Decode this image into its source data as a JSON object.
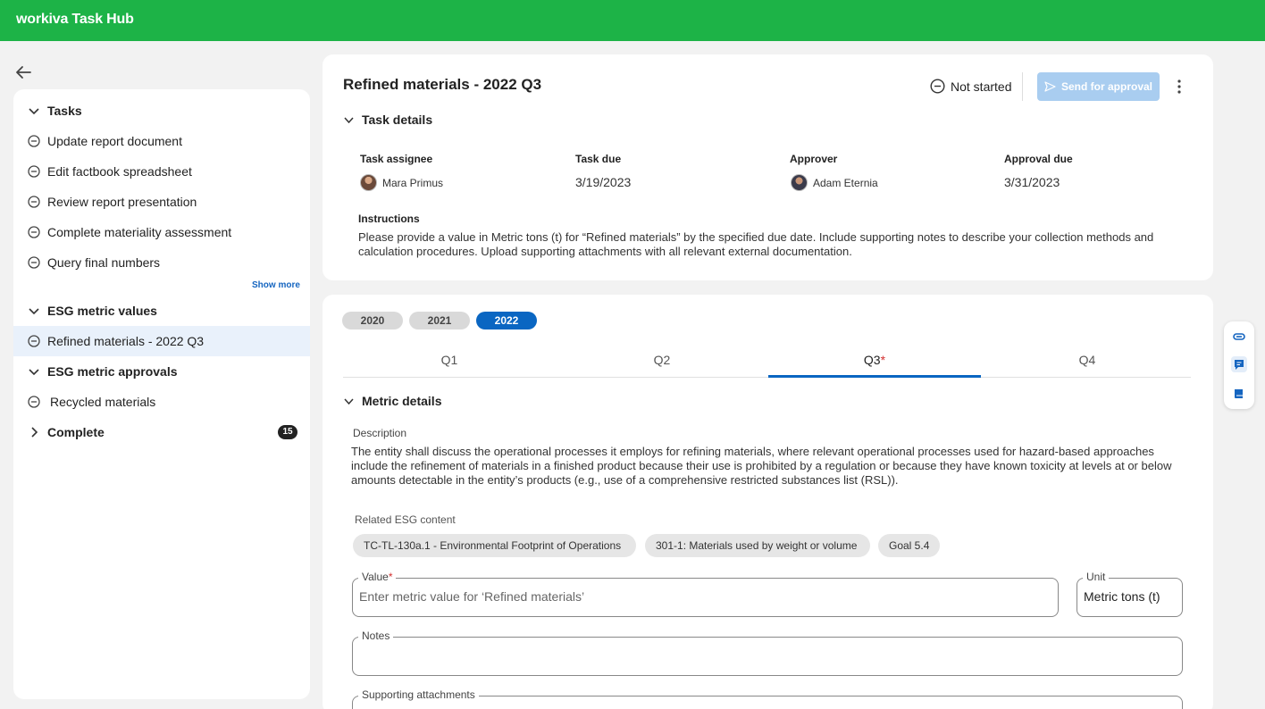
{
  "app": {
    "brand": "workiva Task Hub"
  },
  "sidebar": {
    "sections": [
      {
        "label": "Tasks",
        "items": [
          "Update report document",
          "Edit factbook spreadsheet",
          "Review report presentation",
          "Complete materiality assessment",
          "Query final numbers"
        ],
        "show_more": "Show more"
      },
      {
        "label": "ESG metric values",
        "items": [
          "Refined materials - 2022 Q3"
        ],
        "selected": "Refined materials - 2022 Q3"
      },
      {
        "label": "ESG metric approvals",
        "items": [
          "Recycled materials"
        ]
      },
      {
        "label": "Complete",
        "count": "15",
        "collapsed": true
      }
    ]
  },
  "task": {
    "title": "Refined materials - 2022 Q3",
    "status": "Not started",
    "send_label": "Send for approval",
    "details_header": "Task details",
    "fields": {
      "assignee_label": "Task assignee",
      "assignee": "Mara Primus",
      "due_label": "Task due",
      "due": "3/19/2023",
      "approver_label": "Approver",
      "approver": "Adam Eternia",
      "approval_due_label": "Approval due",
      "approval_due": "3/31/2023"
    },
    "instructions_label": "Instructions",
    "instructions": "Please provide a value in Metric tons (t) for “Refined materials” by the specified due date.  Include supporting notes to describe your collection methods and calculation procedures.  Upload supporting attachments with all relevant external documentation."
  },
  "metric": {
    "years": [
      "2020",
      "2021",
      "2022"
    ],
    "active_year": "2022",
    "quarters": [
      "Q1",
      "Q2",
      "Q3",
      "Q4"
    ],
    "active_quarter": "Q3",
    "required_mark": "*",
    "details_header": "Metric details",
    "description_label": "Description",
    "description": "The entity shall discuss the operational processes it employs for refining materials, where relevant operational processes used for hazard-based approaches include the refinement of materials in a finished product because their use is prohibited by a regulation or because they have known toxicity at levels at or below amounts detectable in the entity’s products (e.g., use of a comprehensive restricted substances list (RSL)).",
    "related_label": "Related ESG content",
    "related": [
      "TC-TL-130a.1 - Environmental Footprint of Operations",
      "301-1: Materials used by weight or volume",
      "Goal 5.4"
    ],
    "value_label": "Value",
    "value_placeholder": "Enter metric value for ‘Refined materials’",
    "unit_label": "Unit",
    "unit_value": "Metric tons (t)",
    "notes_label": "Notes",
    "attachments_label": "Supporting attachments"
  },
  "colors": {
    "brand_green": "#1db347",
    "accent_blue": "#0a66c2",
    "disabled_blue": "#a9cdf0"
  },
  "icons": {
    "back": "arrow-left-icon",
    "status": "minus-circle-icon",
    "send": "send-icon",
    "more": "kebab-icon",
    "rail": [
      "attachment-icon",
      "comment-icon",
      "book-icon"
    ]
  }
}
